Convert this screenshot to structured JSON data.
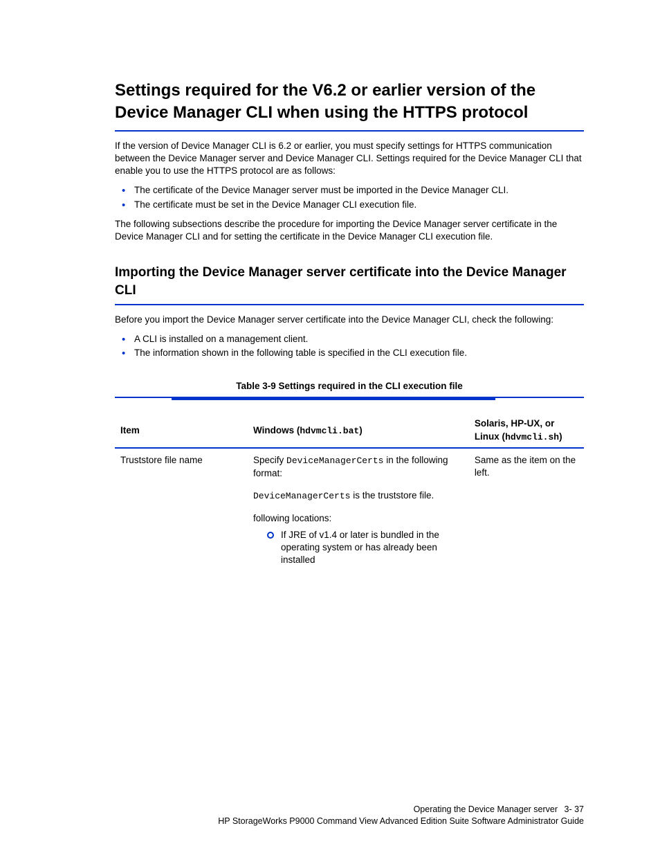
{
  "section1": {
    "heading": "Settings required for the V6.2 or earlier version of the Device Manager CLI when using the HTTPS protocol",
    "p1": "If the version of Device Manager CLI is 6.2 or earlier, you must specify settings for HTTPS communication between the Device Manager server and Device Manager CLI. Settings required for the Device Manager CLI that enable you to use the HTTPS protocol are as follows:",
    "bullets": [
      "The certificate of the Device Manager server must be imported in the Device Manager CLI.",
      "The certificate must be set in the Device Manager CLI execution file."
    ],
    "p2": "The following subsections describe the procedure for importing the Device Manager server certificate in the Device Manager CLI and for setting the certificate in the Device Manager CLI execution file."
  },
  "sub1": {
    "heading": "Importing the Device Manager server certificate into the Device Manager CLI",
    "p1": "Before you import the Device Manager server certificate into the Device Manager CLI, check the following:",
    "bullets": [
      "A CLI is installed on a management client.",
      "The information shown in the following table is specified in the CLI execution file."
    ],
    "table": {
      "caption": "Table 3-9 Settings required in the CLI execution file",
      "headers": [
        "Item",
        "Windows (hdvmcli.bat)",
        "Solaris, HP-UX, or Linux (hdvmcli.sh)"
      ],
      "row1": {
        "item": "Truststore file name",
        "win": {
          "p1": "Specify in the following format:",
          "code": "the truststore file.",
          "p2": "following locations:",
          "sub_bullet": "If JRE of v1.4 or later is bundled in the operating system or has already been installed"
        },
        "sol": "Same as the item on the left."
      },
      "inline_codes": {
        "dm1": "DeviceManagerCerts",
        "dm2": "DeviceManagerCerts"
      }
    }
  },
  "footer": {
    "title": "Operating the Device Manager server",
    "page": "3- 37",
    "doc": "HP StorageWorks P9000 Command View Advanced Edition Suite Software Administrator Guide"
  }
}
